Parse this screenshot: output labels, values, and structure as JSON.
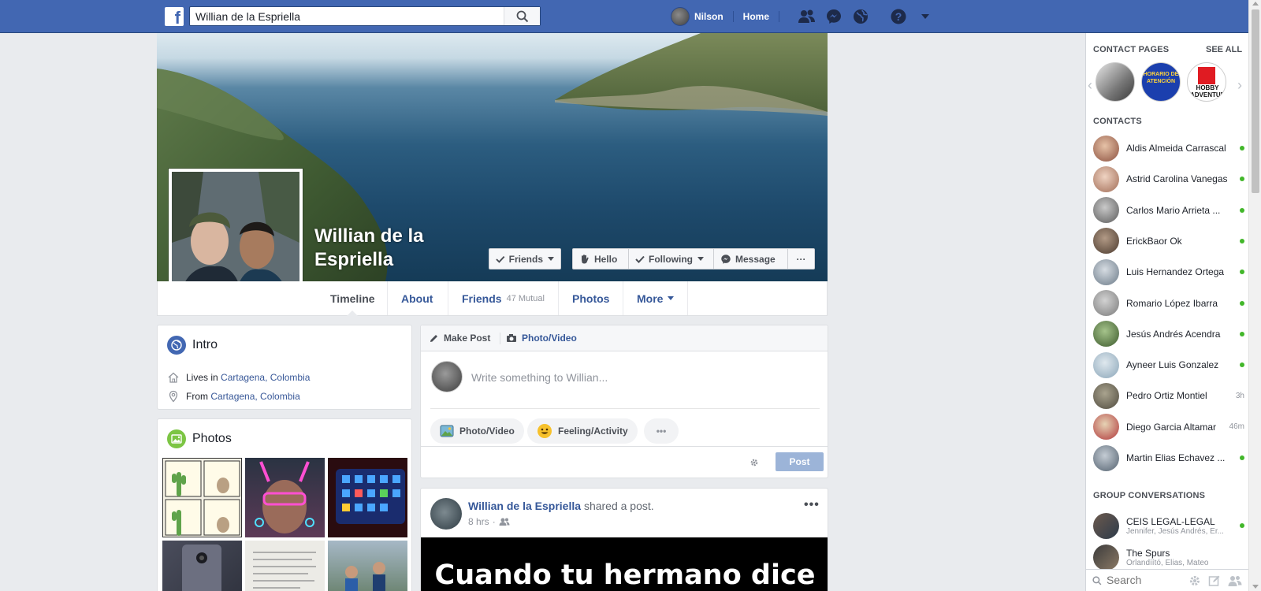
{
  "topbar": {
    "logo": "f",
    "search_value": "Willian de la Espriella",
    "user_name": "Nilson",
    "home_label": "Home",
    "icons": [
      "friend-requests-icon",
      "messenger-icon",
      "notifications-globe-icon",
      "help-icon",
      "account-menu-caret-icon"
    ]
  },
  "profile": {
    "name": "Willian de la Espriella",
    "buttons": {
      "friends": "Friends",
      "hello": "Hello",
      "following": "Following",
      "message": "Message",
      "more": "···"
    },
    "tabs": {
      "timeline": "Timeline",
      "about": "About",
      "friends": "Friends",
      "friends_mutual": "47 Mutual",
      "photos": "Photos",
      "more": "More"
    }
  },
  "intro": {
    "title": "Intro",
    "lives_prefix": "Lives in",
    "lives_place": "Cartagena, Colombia",
    "from_prefix": "From",
    "from_place": "Cartagena, Colombia"
  },
  "photos": {
    "title": "Photos"
  },
  "composer": {
    "make_post": "Make Post",
    "photo_video_tab": "Photo/Video",
    "placeholder": "Write something to Willian...",
    "photo_video": "Photo/Video",
    "feeling": "Feeling/Activity",
    "more": "•••",
    "post_button": "Post"
  },
  "feed_post": {
    "author": "Willian de la Espriella",
    "action": "shared a post.",
    "time": "8 hrs",
    "image_text": "Cuando tu hermano dice"
  },
  "sidebar": {
    "contact_pages_title": "CONTACT PAGES",
    "see_all": "SEE ALL",
    "page_badges": [
      "",
      "HORARIO DE ATENCIÓN",
      "HOBBY ADVENTURE"
    ],
    "contacts_title": "CONTACTS",
    "contacts": [
      {
        "name": "Aldis Almeida Carrascal",
        "status": "online"
      },
      {
        "name": "Astrid Carolina Vanegas",
        "status": "online"
      },
      {
        "name": "Carlos Mario Arrieta ...",
        "status": "online"
      },
      {
        "name": "ErickBaor Ok",
        "status": "online"
      },
      {
        "name": "Luis Hernandez Ortega",
        "status": "online"
      },
      {
        "name": "Romario López Ibarra",
        "status": "online"
      },
      {
        "name": "Jesús Andrés Acendra",
        "status": "online"
      },
      {
        "name": "Ayneer Luis Gonzalez",
        "status": "online"
      },
      {
        "name": "Pedro Ortiz Montiel",
        "status": "3h"
      },
      {
        "name": "Diego Garcia Altamar",
        "status": "46m"
      },
      {
        "name": "Martin Elias Echavez ...",
        "status": "online"
      }
    ],
    "group_title": "GROUP CONVERSATIONS",
    "groups": [
      {
        "name": "CEIS LEGAL-LEGAL",
        "members": "Jennifer, Jesús Andrés, Er...",
        "status": "online"
      },
      {
        "name": "The Spurs",
        "members": "Órlandíító, Elias, Mateo",
        "status": ""
      }
    ],
    "search_placeholder": "Search"
  },
  "colors": {
    "topbar": "#4267b2",
    "link": "#385898",
    "online": "#42b72a",
    "post_button": "#9cb4d8"
  }
}
